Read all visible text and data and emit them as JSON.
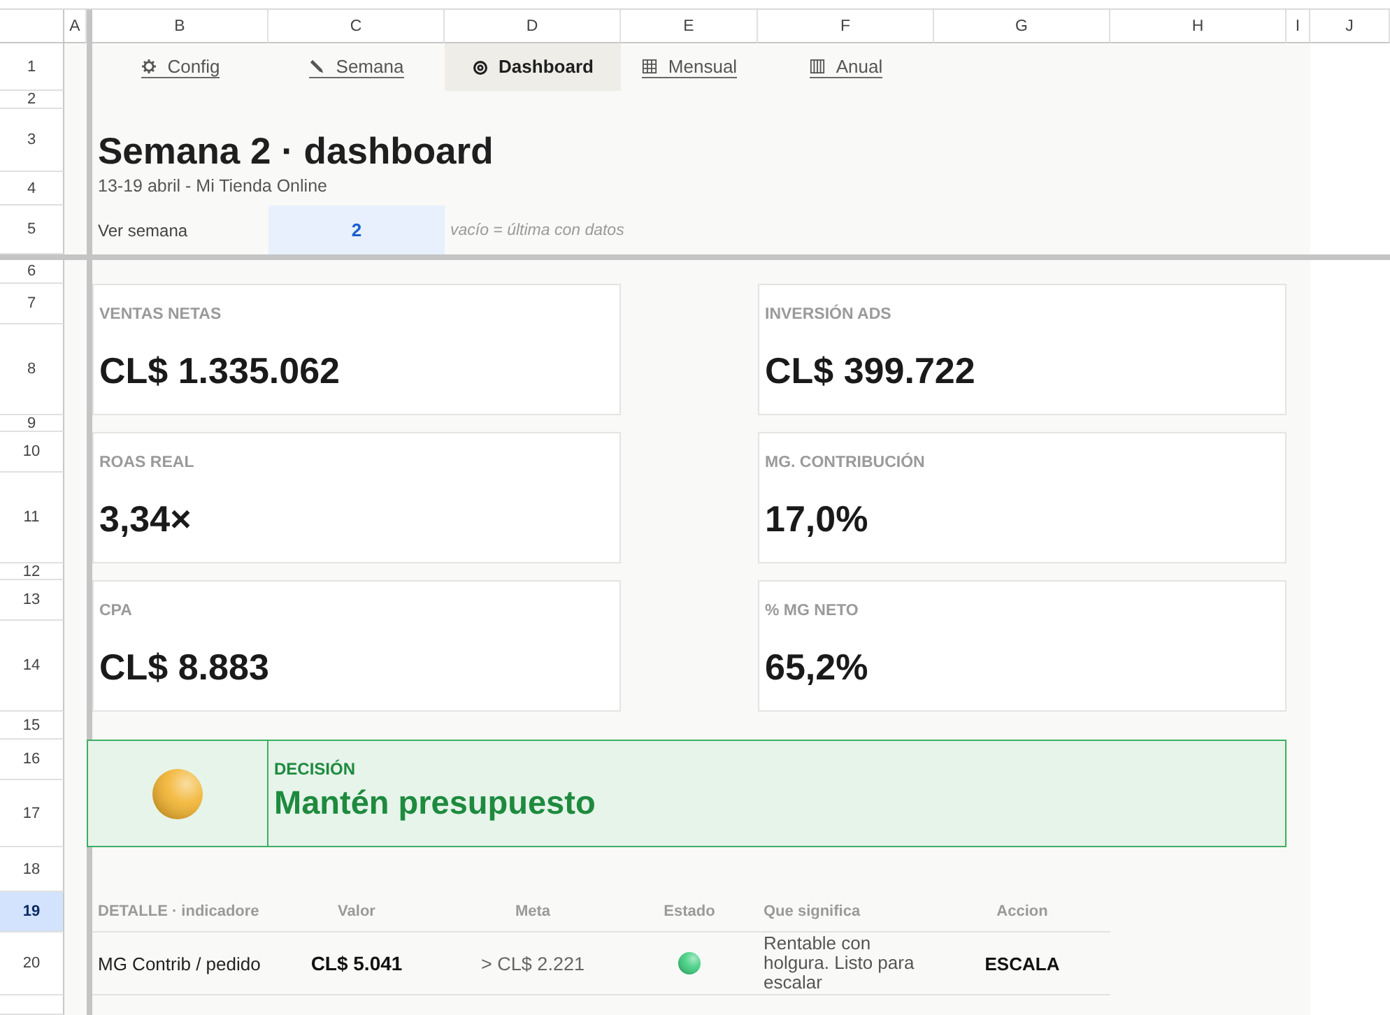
{
  "column_headers": [
    {
      "label": "A",
      "selected": false
    },
    {
      "label": "B",
      "selected": false
    },
    {
      "label": "C",
      "selected": false
    },
    {
      "label": "D",
      "selected": false
    },
    {
      "label": "E",
      "selected": false
    },
    {
      "label": "F",
      "selected": false
    },
    {
      "label": "G",
      "selected": false
    },
    {
      "label": "H",
      "selected": false
    },
    {
      "label": "I",
      "selected": false
    },
    {
      "label": "J",
      "selected": false
    }
  ],
  "row_headers": [
    {
      "label": "1",
      "selected": false
    },
    {
      "label": "2",
      "selected": false
    },
    {
      "label": "3",
      "selected": false
    },
    {
      "label": "4",
      "selected": false
    },
    {
      "label": "5",
      "selected": false
    },
    {
      "label": "6",
      "selected": false
    },
    {
      "label": "7",
      "selected": false
    },
    {
      "label": "8",
      "selected": false
    },
    {
      "label": "9",
      "selected": false
    },
    {
      "label": "10",
      "selected": false
    },
    {
      "label": "11",
      "selected": false
    },
    {
      "label": "12",
      "selected": false
    },
    {
      "label": "13",
      "selected": false
    },
    {
      "label": "14",
      "selected": false
    },
    {
      "label": "15",
      "selected": false
    },
    {
      "label": "16",
      "selected": false
    },
    {
      "label": "17",
      "selected": false
    },
    {
      "label": "18",
      "selected": false
    },
    {
      "label": "19",
      "selected": true
    },
    {
      "label": "20",
      "selected": false
    }
  ],
  "nav_tabs": [
    {
      "label": "Config",
      "selected": false
    },
    {
      "label": "Semana",
      "selected": false
    },
    {
      "label": "Dashboard",
      "selected": true
    },
    {
      "label": "Mensual",
      "selected": false
    },
    {
      "label": "Anual",
      "selected": false
    }
  ],
  "header": {
    "title": "Semana 2 · dashboard",
    "subtitle": "13-19 abril - Mi Tienda Online"
  },
  "week_selector": {
    "label": "Ver semana",
    "value": "2",
    "hint": "vacío = última con datos"
  },
  "kpi_cards": [
    {
      "label": "VENTAS NETAS",
      "value": "CL$ 1.335.062"
    },
    {
      "label": "INVERSIÓN ADS",
      "value": "CL$ 399.722"
    },
    {
      "label": "ROAS REAL",
      "value": "3,34×"
    },
    {
      "label": "MG. CONTRIBUCIÓN",
      "value": "17,0%"
    },
    {
      "label": "CPA",
      "value": "CL$ 8.883"
    },
    {
      "label": "% MG NETO",
      "value": "65,2%"
    }
  ],
  "decision": {
    "label": "DECISIÓN",
    "text": "Mantén presupuesto",
    "color": "#f2b431"
  },
  "detail_table": {
    "columns": [
      "DETALLE · indicadore",
      "Valor",
      "Meta",
      "Estado",
      "Que significa",
      "Accion"
    ],
    "rows": [
      {
        "indicator": "MG Contrib / pedido",
        "value": "CL$ 5.041",
        "target": "> CL$ 2.221",
        "color": "#3fcf7f",
        "meaning": "Rentable con holgura. Listo para escalar",
        "action": "ESCALA"
      }
    ]
  }
}
